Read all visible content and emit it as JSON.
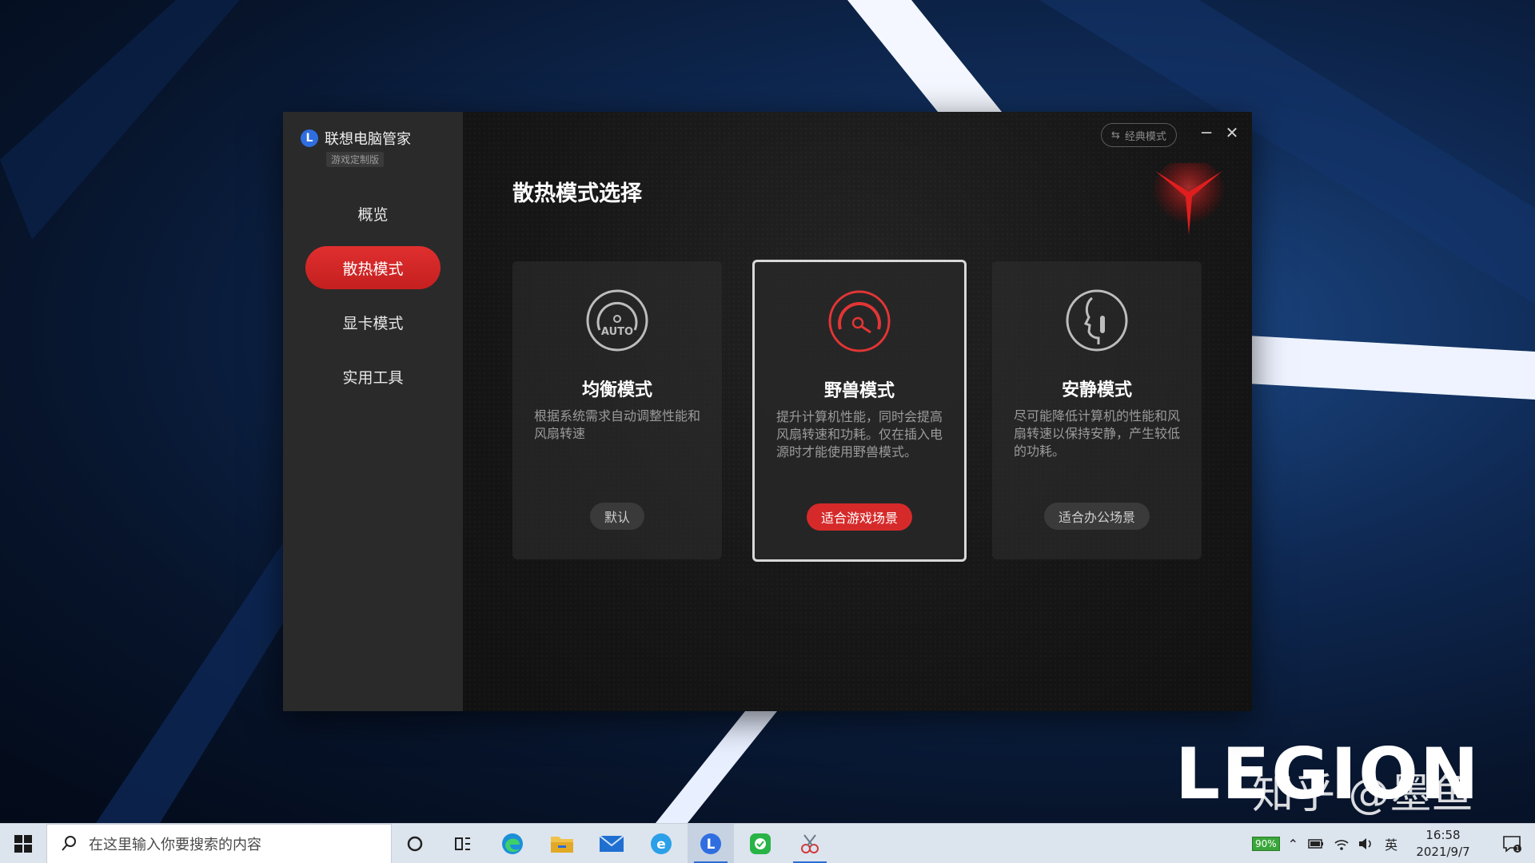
{
  "app": {
    "brand_name": "联想电脑管家",
    "brand_subtitle": "游戏定制版",
    "classic_mode_label": "经典模式",
    "nav": [
      {
        "label": "概览",
        "active": false
      },
      {
        "label": "散热模式",
        "active": true
      },
      {
        "label": "显卡模式",
        "active": false
      },
      {
        "label": "实用工具",
        "active": false
      }
    ],
    "page_title": "散热模式选择",
    "modes": [
      {
        "title": "均衡模式",
        "description": "根据系统需求自动调整性能和风扇转速",
        "tag": "默认",
        "icon": "auto-gauge-icon",
        "icon_text": "AUTO",
        "selected": false
      },
      {
        "title": "野兽模式",
        "description": "提升计算机性能，同时会提高风扇转速和功耗。仅在插入电源时才能使用野兽模式。",
        "tag": "适合游戏场景",
        "icon": "performance-gauge-icon",
        "selected": true
      },
      {
        "title": "安静模式",
        "description": "尽可能降低计算机的性能和风扇转速以保持安静，产生较低的功耗。",
        "tag": "适合办公场景",
        "icon": "quiet-silhouette-icon",
        "selected": false
      }
    ],
    "accent_color": "#d62a2a"
  },
  "desktop": {
    "wallpaper_logo": "LEGION",
    "watermark": "知乎 @墨鱼"
  },
  "taskbar": {
    "search_placeholder": "在这里输入你要搜索的内容",
    "pinned_icons": [
      "task-view-icon",
      "widgets-icon",
      "edge-icon",
      "file-explorer-icon",
      "mail-icon",
      "ie-icon",
      "lenovo-vantage-icon",
      "wechat-icon",
      "snipping-icon"
    ],
    "battery_percent": "90%",
    "input_language": "英",
    "time": "16:58",
    "date": "2021/9/7",
    "notification_count": "1"
  }
}
